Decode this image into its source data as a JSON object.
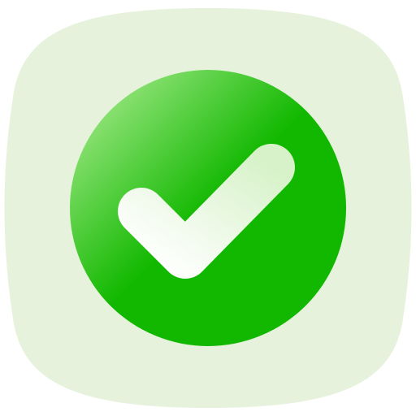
{
  "icon": {
    "name": "checkmark-icon",
    "colors": {
      "background_tile": "#e6f2dc",
      "circle_primary": "#12b800",
      "circle_highlight": "#b7f09d",
      "check_light": "#ffffff",
      "check_shade": "#cfeec0"
    }
  }
}
